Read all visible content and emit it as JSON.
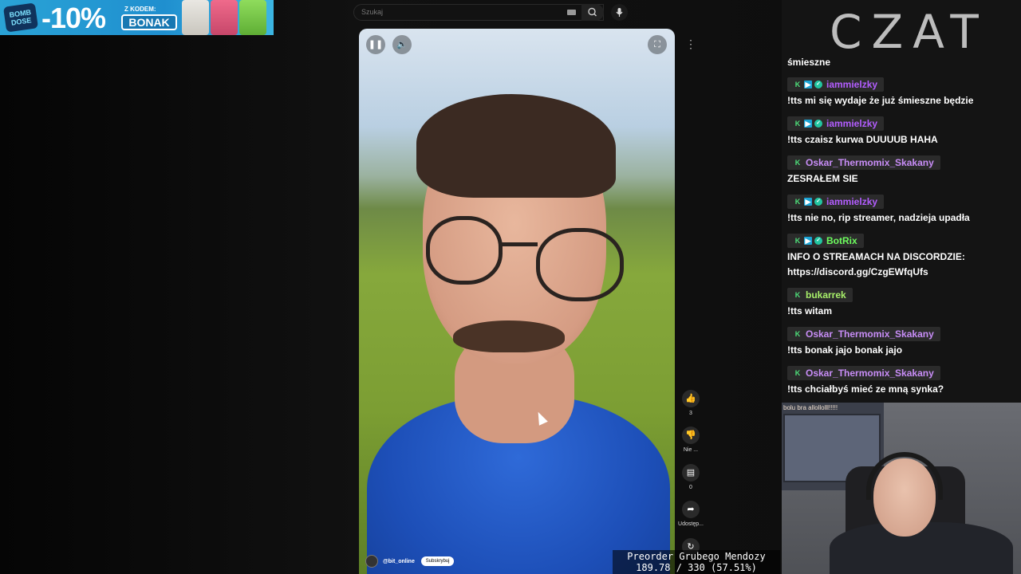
{
  "promo": {
    "brand": "BOMB DOSE",
    "discount": "-10%",
    "code_label": "Z KODEM:",
    "code": "BONAK"
  },
  "search": {
    "placeholder": "Szukaj"
  },
  "video": {
    "channel": "@bit_online",
    "subscribe_label": "Subskrybuj",
    "actions": {
      "like_count": "3",
      "dislike_label": "Nie ...",
      "comments_count": "0",
      "share_label": "Udostęp..."
    }
  },
  "player_text": {
    "line1": "Preorder Grubego Mendozy",
    "line2": "189.78 / 330 (57.51%)"
  },
  "chat": {
    "title": "CZAT",
    "top_text": "śmieszne",
    "messages": [
      {
        "user": "iammielzky",
        "color": "#b35dff",
        "badges": [
          "k",
          "p",
          "v"
        ],
        "text": "!tts mi się wydaje że już śmieszne będzie"
      },
      {
        "user": "iammielzky",
        "color": "#b35dff",
        "badges": [
          "k",
          "p",
          "v"
        ],
        "text": "!tts czaisz kurwa DUUUUB HAHA"
      },
      {
        "user": "Oskar_Thermomix_Skakany",
        "color": "#c88df7",
        "badges": [
          "k"
        ],
        "text": "ZESRAŁEM SIE"
      },
      {
        "user": "iammielzky",
        "color": "#b35dff",
        "badges": [
          "k",
          "p",
          "v"
        ],
        "text": "!tts nie no, rip streamer, nadzieja upadła"
      },
      {
        "user": "BotRix",
        "color": "#6dfc5e",
        "badges": [
          "k",
          "p",
          "v"
        ],
        "text": "INFO O STREAMACH NA DISCORDZIE: https://discord.gg/CzgEWfqUfs"
      },
      {
        "user": "bukarrek",
        "color": "#a8f06a",
        "badges": [
          "k"
        ],
        "text": "!tts witam"
      },
      {
        "user": "Oskar_Thermomix_Skakany",
        "color": "#c88df7",
        "badges": [
          "k"
        ],
        "text": "!tts bonak jajo bonak jajo"
      },
      {
        "user": "Oskar_Thermomix_Skakany",
        "color": "#c88df7",
        "badges": [
          "k"
        ],
        "text": "!tts chciałbyś mieć ze mną synka?"
      }
    ]
  },
  "webcam": {
    "wall_note": "bolu bra allollolll!!!!!"
  }
}
